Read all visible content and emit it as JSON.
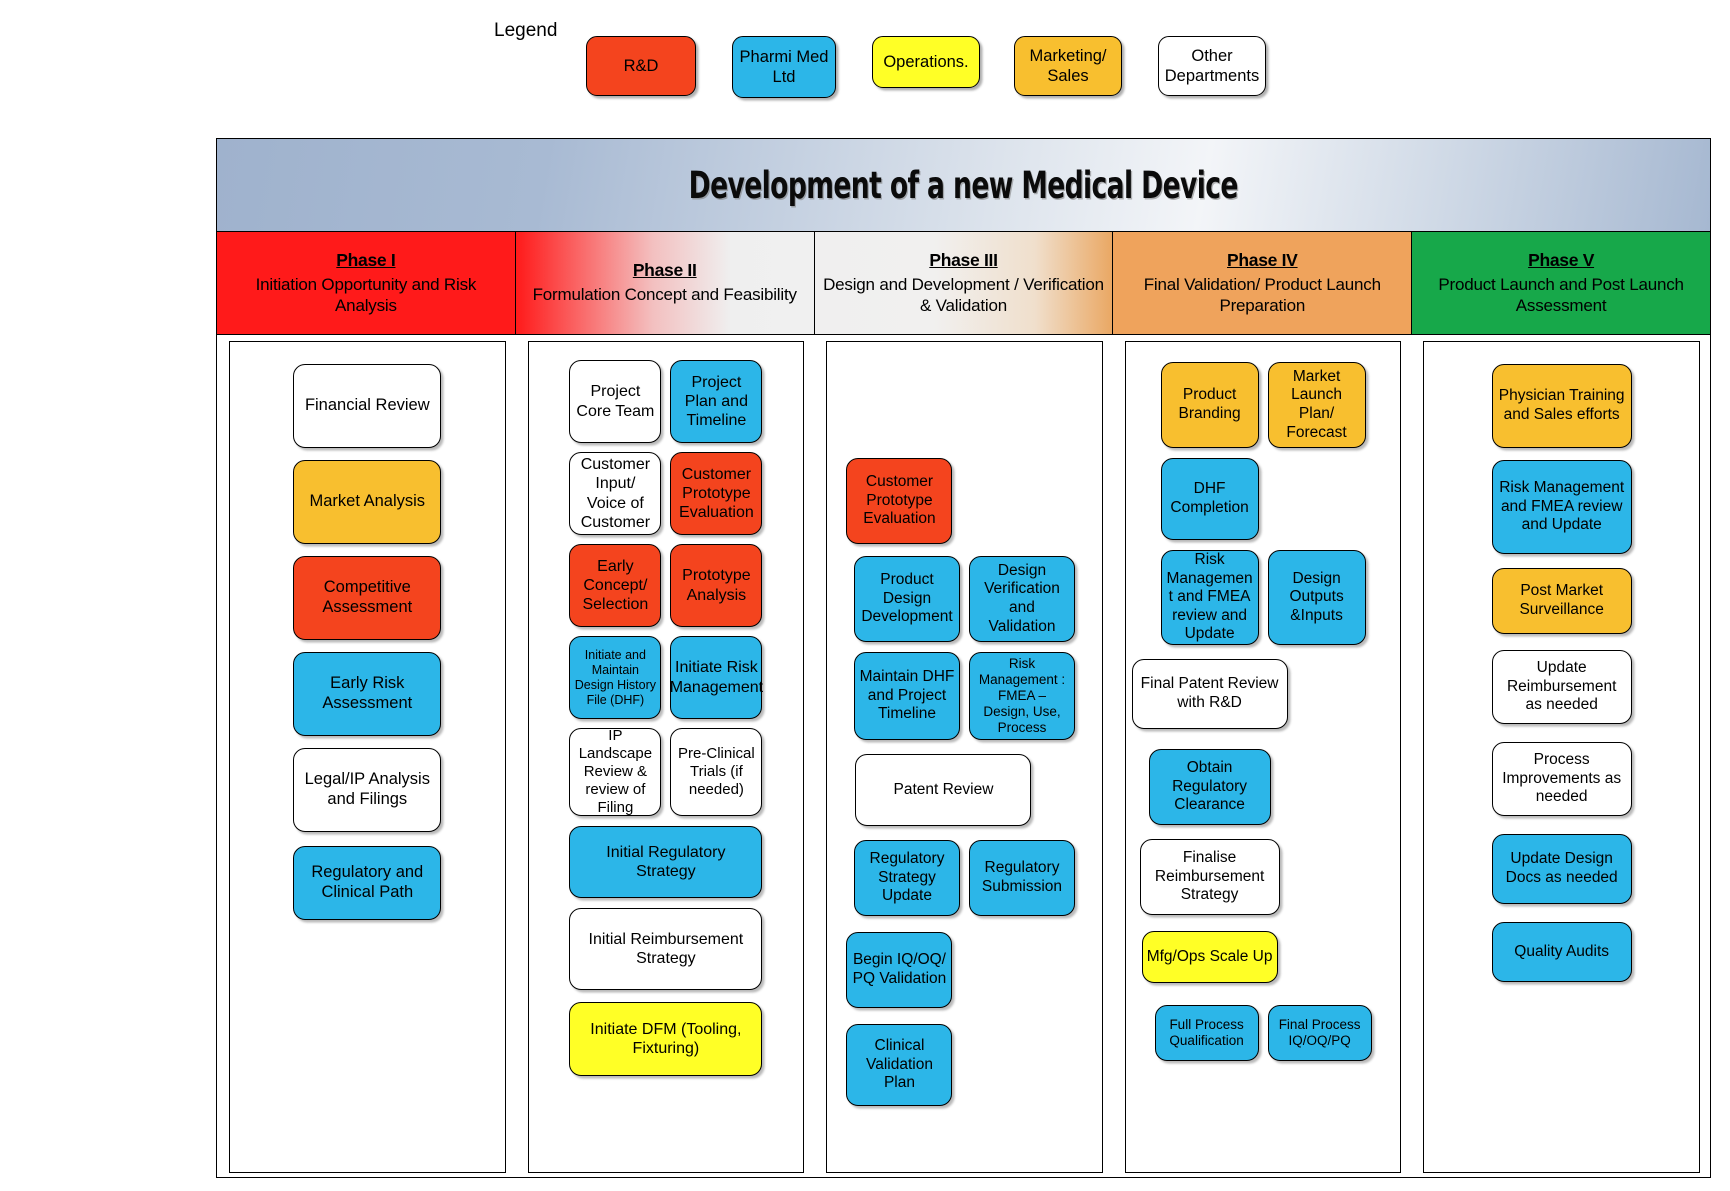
{
  "legend": {
    "label": "Legend",
    "items": [
      {
        "name": "R&D",
        "color": "#f4441e",
        "key": "rd"
      },
      {
        "name": "Pharmi Med Ltd",
        "color": "#2cb6e8",
        "key": "pml"
      },
      {
        "name": "Operations.",
        "color": "#ffff26",
        "key": "ops"
      },
      {
        "name": "Marketing/ Sales",
        "color": "#f8bf2f",
        "key": "mkt"
      },
      {
        "name": "Other Departments",
        "color": "#ffffff",
        "key": "other"
      }
    ]
  },
  "diagram": {
    "title": "Development of a new Medical Device",
    "phases": [
      {
        "id": "phase-1",
        "title": "Phase I",
        "subtitle": "Initiation Opportunity and Risk Analysis",
        "header_color": "#ff1a1a",
        "nodes": [
          {
            "label": "Financial Review",
            "dept": "other"
          },
          {
            "label": "Market Analysis",
            "dept": "mkt"
          },
          {
            "label": "Competitive Assessment",
            "dept": "rd"
          },
          {
            "label": "Early Risk Assessment",
            "dept": "pml"
          },
          {
            "label": "Legal/IP Analysis and Filings",
            "dept": "other"
          },
          {
            "label": "Regulatory and Clinical Path",
            "dept": "pml"
          }
        ]
      },
      {
        "id": "phase-2",
        "title": "Phase II",
        "subtitle": "Formulation Concept and Feasibility",
        "header_color": "#ff1a1a",
        "nodes": [
          {
            "label": "Project Core Team",
            "dept": "other"
          },
          {
            "label": "Project Plan and Timeline",
            "dept": "pml"
          },
          {
            "label": "Customer Input/ Voice of Customer",
            "dept": "other"
          },
          {
            "label": "Customer Prototype Evaluation",
            "dept": "rd"
          },
          {
            "label": "Early Concept/ Selection",
            "dept": "rd"
          },
          {
            "label": "Prototype Analysis",
            "dept": "rd"
          },
          {
            "label": "Initiate and Maintain Design History File (DHF)",
            "dept": "pml"
          },
          {
            "label": "Initiate Risk Management",
            "dept": "pml"
          },
          {
            "label": "IP Landscape Review & review of Filing",
            "dept": "other"
          },
          {
            "label": "Pre-Clinical Trials (if needed)",
            "dept": "other"
          },
          {
            "label": "Initial Regulatory Strategy",
            "dept": "pml"
          },
          {
            "label": "Initial Reimbursement Strategy",
            "dept": "other"
          },
          {
            "label": "Initiate DFM (Tooling, Fixturing)",
            "dept": "ops"
          }
        ]
      },
      {
        "id": "phase-3",
        "title": "Phase III",
        "subtitle": "Design and Development / Verification & Validation",
        "header_color": "#f0efef",
        "nodes": [
          {
            "label": "Customer Prototype Evaluation",
            "dept": "rd"
          },
          {
            "label": "Product Design Development",
            "dept": "pml"
          },
          {
            "label": "Design Verification and Validation",
            "dept": "pml"
          },
          {
            "label": "Maintain DHF and Project Timeline",
            "dept": "pml"
          },
          {
            "label": "Risk Management : FMEA – Design, Use, Process",
            "dept": "pml"
          },
          {
            "label": "Patent Review",
            "dept": "other"
          },
          {
            "label": "Regulatory Strategy Update",
            "dept": "pml"
          },
          {
            "label": "Regulatory Submission",
            "dept": "pml"
          },
          {
            "label": "Begin IQ/OQ/ PQ Validation",
            "dept": "pml"
          },
          {
            "label": "Clinical Validation Plan",
            "dept": "pml"
          }
        ]
      },
      {
        "id": "phase-4",
        "title": "Phase IV",
        "subtitle": "Final Validation/ Product Launch Preparation",
        "header_color": "#efa35c",
        "nodes": [
          {
            "label": "Product Branding",
            "dept": "mkt"
          },
          {
            "label": "Market Launch Plan/ Forecast",
            "dept": "mkt"
          },
          {
            "label": "DHF Completion",
            "dept": "pml"
          },
          {
            "label": "Risk Managemen t and FMEA review and Update",
            "dept": "pml"
          },
          {
            "label": "Design Outputs &Inputs",
            "dept": "pml"
          },
          {
            "label": "Final Patent Review with R&D",
            "dept": "other"
          },
          {
            "label": "Obtain Regulatory Clearance",
            "dept": "pml"
          },
          {
            "label": "Finalise Reimbursement Strategy",
            "dept": "other"
          },
          {
            "label": "Mfg/Ops Scale Up",
            "dept": "ops"
          },
          {
            "label": "Full Process Qualification",
            "dept": "pml"
          },
          {
            "label": "Final Process IQ/OQ/PQ",
            "dept": "pml"
          }
        ]
      },
      {
        "id": "phase-5",
        "title": "Phase V",
        "subtitle": "Product Launch and Post Launch Assessment",
        "header_color": "#17a84a",
        "nodes": [
          {
            "label": "Physician Training and Sales efforts",
            "dept": "mkt"
          },
          {
            "label": "Risk Management and FMEA review and Update",
            "dept": "pml"
          },
          {
            "label": "Post Market Surveillance",
            "dept": "mkt"
          },
          {
            "label": "Update Reimbursement as needed",
            "dept": "other"
          },
          {
            "label": "Process Improvements as needed",
            "dept": "other"
          },
          {
            "label": "Update Design Docs as needed",
            "dept": "pml"
          },
          {
            "label": "Quality Audits",
            "dept": "pml"
          }
        ]
      }
    ]
  }
}
